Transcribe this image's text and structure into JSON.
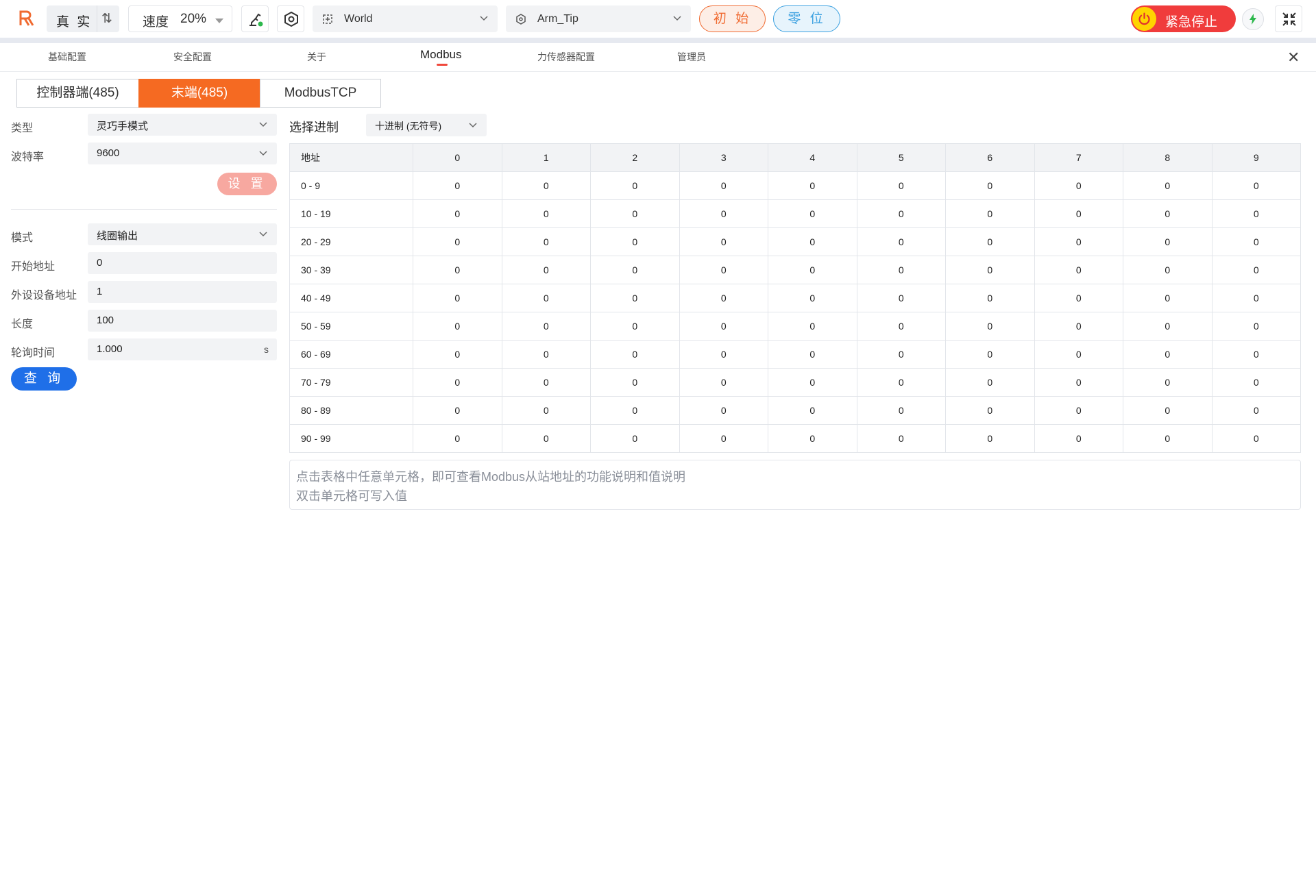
{
  "header": {
    "logo_text": "Ȣ",
    "mode_label": "真 实",
    "speed_label": "速度",
    "speed_value": "20%",
    "frame_select": "World",
    "tool_select": "Arm_Tip",
    "init_label": "初 始",
    "zero_label": "零 位",
    "estop_label": "紧急停止",
    "colors": {
      "accent_orange": "#f06a30",
      "accent_blue": "#3aa0e0",
      "estop_red": "#f03c3c",
      "primary_blue": "#1f6fe8"
    }
  },
  "tabs": [
    "基础配置",
    "安全配置",
    "关于",
    "Modbus",
    "力传感器配置",
    "管理员"
  ],
  "active_tab": "Modbus",
  "subtabs": [
    "控制器端(485)",
    "末端(485)",
    "ModbusTCP"
  ],
  "active_subtab": "末端(485)",
  "form": {
    "type_label": "类型",
    "type_value": "灵巧手模式",
    "baud_label": "波特率",
    "baud_value": "9600",
    "set_label": "设 置",
    "mode_label": "模式",
    "mode_value": "线圈输出",
    "start_label": "开始地址",
    "start_value": "0",
    "device_label": "外设设备地址",
    "device_value": "1",
    "length_label": "长度",
    "length_value": "100",
    "poll_label": "轮询时间",
    "poll_value": "1.000",
    "poll_unit": "s",
    "query_label": "查 询"
  },
  "radix": {
    "label": "选择进制",
    "value": "十进制 (无符号)"
  },
  "table": {
    "header": [
      "地址",
      "0",
      "1",
      "2",
      "3",
      "4",
      "5",
      "6",
      "7",
      "8",
      "9"
    ],
    "rows": [
      [
        "0 - 9",
        "0",
        "0",
        "0",
        "0",
        "0",
        "0",
        "0",
        "0",
        "0",
        "0"
      ],
      [
        "10 - 19",
        "0",
        "0",
        "0",
        "0",
        "0",
        "0",
        "0",
        "0",
        "0",
        "0"
      ],
      [
        "20 - 29",
        "0",
        "0",
        "0",
        "0",
        "0",
        "0",
        "0",
        "0",
        "0",
        "0"
      ],
      [
        "30 - 39",
        "0",
        "0",
        "0",
        "0",
        "0",
        "0",
        "0",
        "0",
        "0",
        "0"
      ],
      [
        "40 - 49",
        "0",
        "0",
        "0",
        "0",
        "0",
        "0",
        "0",
        "0",
        "0",
        "0"
      ],
      [
        "50 - 59",
        "0",
        "0",
        "0",
        "0",
        "0",
        "0",
        "0",
        "0",
        "0",
        "0"
      ],
      [
        "60 - 69",
        "0",
        "0",
        "0",
        "0",
        "0",
        "0",
        "0",
        "0",
        "0",
        "0"
      ],
      [
        "70 - 79",
        "0",
        "0",
        "0",
        "0",
        "0",
        "0",
        "0",
        "0",
        "0",
        "0"
      ],
      [
        "80 - 89",
        "0",
        "0",
        "0",
        "0",
        "0",
        "0",
        "0",
        "0",
        "0",
        "0"
      ],
      [
        "90 - 99",
        "0",
        "0",
        "0",
        "0",
        "0",
        "0",
        "0",
        "0",
        "0",
        "0"
      ]
    ]
  },
  "hint": {
    "line1": "点击表格中任意单元格，即可查看Modbus从站地址的功能说明和值说明",
    "line2": "双击单元格可写入值"
  },
  "icons": [
    "logo-icon",
    "swap-icon",
    "robot-arm-icon",
    "settings-hex-icon",
    "frame-icon",
    "tool-icon",
    "power-icon",
    "lightning-icon",
    "collapse-icon",
    "close-icon",
    "chevron-down-icon"
  ]
}
